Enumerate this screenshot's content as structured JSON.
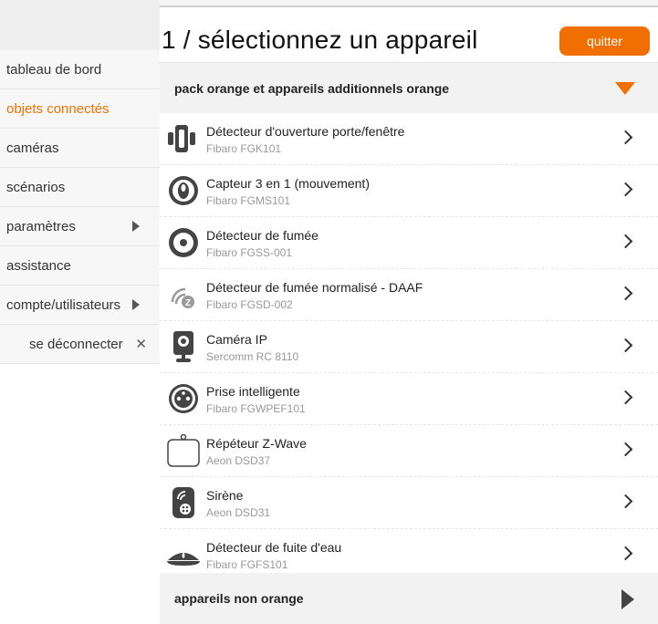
{
  "sidebar": {
    "items": [
      {
        "label": "tableau de bord"
      },
      {
        "label": "objets connectés"
      },
      {
        "label": "caméras"
      },
      {
        "label": "scénarios"
      },
      {
        "label": "paramètres"
      },
      {
        "label": "assistance"
      },
      {
        "label": "compte/utilisateurs"
      },
      {
        "label": "se déconnecter"
      }
    ],
    "active_color": "#ee7203"
  },
  "header": {
    "title": "1 / sélectionnez un appareil",
    "quit_label": "quitter",
    "accent": "#f16e00"
  },
  "sections": {
    "orange_pack": "pack orange et appareils additionnels orange",
    "non_orange": "appareils non orange"
  },
  "devices": [
    {
      "name": "Détecteur d'ouverture porte/fenêtre",
      "model": "Fibaro FGK101",
      "icon": "door-sensor-icon"
    },
    {
      "name": "Capteur 3 en 1 (mouvement)",
      "model": "Fibaro FGMS101",
      "icon": "motion-sensor-icon"
    },
    {
      "name": "Détecteur de fumée",
      "model": "Fibaro FGSS-001",
      "icon": "smoke-detector-icon"
    },
    {
      "name": "Détecteur de fumée normalisé - DAAF",
      "model": "Fibaro FGSD-002",
      "icon": "smoke-daaf-icon"
    },
    {
      "name": "Caméra IP",
      "model": "Sercomm RC 8110",
      "icon": "ip-camera-icon"
    },
    {
      "name": "Prise intelligente",
      "model": "Fibaro FGWPEF101",
      "icon": "smart-plug-icon"
    },
    {
      "name": "Répéteur Z-Wave",
      "model": "Aeon DSD37",
      "icon": "zwave-repeater-icon"
    },
    {
      "name": "Sirène",
      "model": "Aeon DSD31",
      "icon": "siren-icon"
    },
    {
      "name": "Détecteur de fuite d'eau",
      "model": "Fibaro FGFS101",
      "icon": "water-leak-icon"
    }
  ]
}
